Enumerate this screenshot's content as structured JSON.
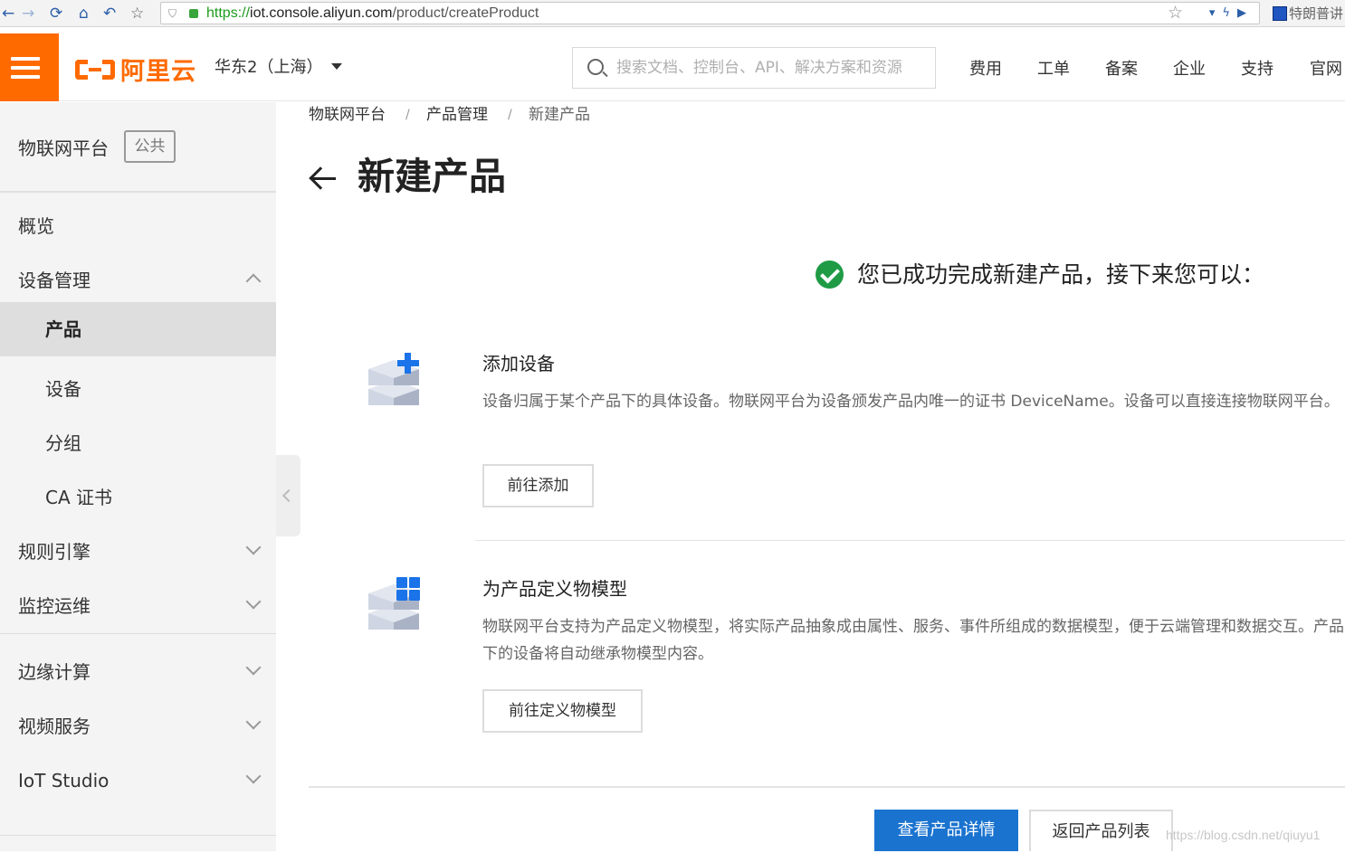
{
  "browser": {
    "url_protocol": "https://",
    "url_host": "iot.console.aliyun.com",
    "url_path": "/product/createProduct",
    "extension_label": "特朗普讲"
  },
  "header": {
    "logo_text": "阿里云",
    "region": "华东2（上海）",
    "search_placeholder": "搜索文档、控制台、API、解决方案和资源",
    "nav": [
      "费用",
      "工单",
      "备案",
      "企业",
      "支持",
      "官网"
    ]
  },
  "sidebar": {
    "title": "物联网平台",
    "badge": "公共",
    "items": [
      {
        "label": "概览"
      },
      {
        "label": "设备管理"
      },
      {
        "label": "产品"
      },
      {
        "label": "设备"
      },
      {
        "label": "分组"
      },
      {
        "label": "CA 证书"
      },
      {
        "label": "规则引擎"
      },
      {
        "label": "监控运维"
      },
      {
        "label": "边缘计算"
      },
      {
        "label": "视频服务"
      },
      {
        "label": "IoT Studio"
      }
    ]
  },
  "breadcrumb": [
    "物联网平台",
    "产品管理",
    "新建产品"
  ],
  "page": {
    "title": "新建产品",
    "success_message": "您已成功完成新建产品，接下来您可以："
  },
  "steps": [
    {
      "title": "添加设备",
      "description": "设备归属于某个产品下的具体设备。物联网平台为设备颁发产品内唯一的证书 DeviceName。设备可以直接连接物联网平台。",
      "button": "前往添加"
    },
    {
      "title": "为产品定义物模型",
      "description": "物联网平台支持为产品定义物模型，将实际产品抽象成由属性、服务、事件所组成的数据模型，便于云端管理和数据交互。产品下的设备将自动继承物模型内容。",
      "button": "前往定义物模型"
    }
  ],
  "footer": {
    "primary_button": "查看产品详情",
    "secondary_button": "返回产品列表",
    "watermark": "https://blog.csdn.net/qiuyu1"
  },
  "colors": {
    "brand_orange": "#ff6a00",
    "primary_blue": "#1a73cf",
    "success_green": "#1f9b45"
  }
}
